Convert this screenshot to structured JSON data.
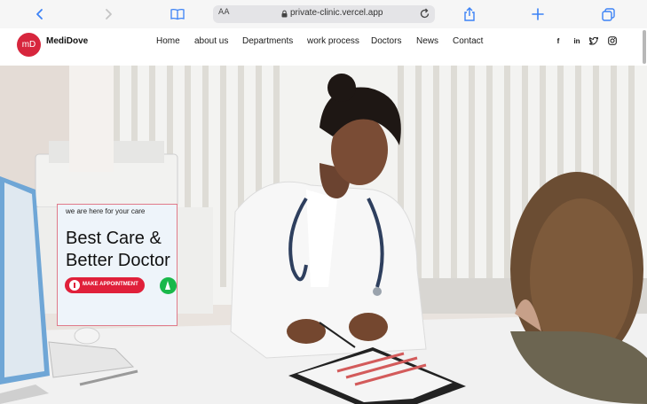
{
  "browser": {
    "text_size_label": "AA",
    "url": "private-clinic.vercel.app"
  },
  "site": {
    "logo_text": "mD",
    "brand_name": "MediDove",
    "nav": [
      {
        "label": "Home"
      },
      {
        "label": "about us"
      },
      {
        "label": "Departments"
      },
      {
        "label": "work process"
      },
      {
        "label": "Doctors"
      },
      {
        "label": "News"
      },
      {
        "label": "Contact"
      }
    ],
    "social_icons": [
      "facebook-icon",
      "linkedin-icon",
      "twitter-icon",
      "instagram-icon"
    ],
    "social_glyphs": {
      "facebook": "f",
      "linkedin": "in"
    }
  },
  "hero": {
    "tagline": "we are here for your care",
    "heading_line1": "Best Care &",
    "heading_line2": "Better Doctor",
    "appointment_button": "MAKE APPOINTMENT"
  },
  "colors": {
    "accent_red": "#d7263d",
    "button_red": "#e0203a",
    "green": "#19b84a",
    "card_bg": "#eef4fa"
  }
}
